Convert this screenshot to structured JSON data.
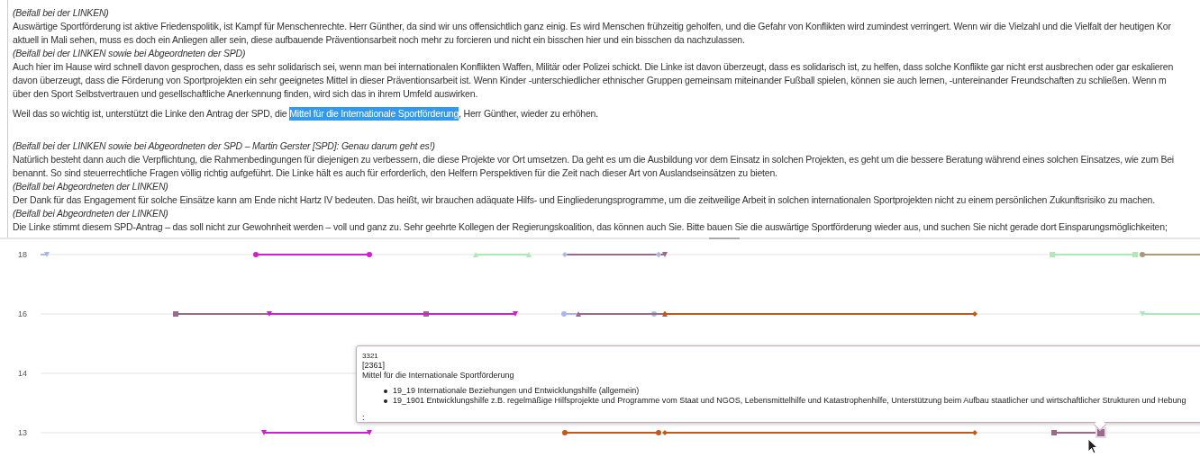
{
  "transcript": [
    {
      "kind": "applause",
      "lines": [
        [
          {
            "text": "(Beifall bei der LINKEN)",
            "selected": false
          }
        ]
      ]
    },
    {
      "kind": "speech",
      "lines": [
        [
          {
            "text": "Auswärtige Sportförderung ist aktive Friedenspolitik, ist Kampf für Menschenrechte. Herr Günther, da sind wir uns offensichtlich ganz einig. Es wird Menschen frühzeitig geholfen, und die Gefahr von Konflikten wird zumindest verringert. Wenn wir die Vielzahl und die Vielfalt der heutigen Kor",
            "selected": false
          }
        ],
        [
          {
            "text": "aktuell in Mali sehen, muss es doch ein Anliegen aller sein, diese aufbauende Präventionsarbeit noch mehr zu forcieren und nicht ein bisschen hier und ein bisschen da nachzulassen.",
            "selected": false
          }
        ]
      ]
    },
    {
      "kind": "applause",
      "lines": [
        [
          {
            "text": "(Beifall bei der LINKEN sowie bei Abgeordneten der SPD)",
            "selected": false
          }
        ]
      ]
    },
    {
      "kind": "speech",
      "lines": [
        [
          {
            "text": "Auch hier im Hause wird schnell davon gesprochen, dass es sehr solidarisch sei, wenn man bei internationalen Konflikten Waffen, Militär oder Polizei schickt. Die Linke ist davon überzeugt, dass es solidarisch ist, zu helfen, dass solche Konflikte gar nicht erst ausbrechen oder gar eskalieren",
            "selected": false
          }
        ],
        [
          {
            "text": "davon überzeugt, dass die Förderung von Sportprojekten ein sehr geeignetes Mittel in dieser Präventionsarbeit ist. Wenn Kinder -unterschiedlicher ethnischer Gruppen gemeinsam miteinander Fußball spielen, können sie auch lernen, -untereinander Freundschaften zu schließen. Wenn m",
            "selected": false
          }
        ],
        [
          {
            "text": "über den Sport Selbstvertrauen und gesellschaftliche Anerkennung finden, wird sich das in ihrem Umfeld auswirken.",
            "selected": false
          }
        ]
      ]
    },
    {
      "kind": "paragraph",
      "lines": [
        [
          {
            "text": "Weil das so wichtig ist, unterstützt die Linke den Antrag der SPD, die ",
            "selected": false
          },
          {
            "text": "Mittel für die Internationale Sportförderung",
            "selected": true
          },
          {
            "text": ", Herr Günther, wieder zu erhöhen.",
            "selected": false
          }
        ]
      ]
    },
    {
      "kind": "applause",
      "lines": [
        [
          {
            "text": "(Beifall bei der LINKEN sowie bei Abgeordneten der SPD – Martin Gerster [SPD]: Genau darum geht es!)",
            "selected": false
          }
        ]
      ]
    },
    {
      "kind": "speech",
      "lines": [
        [
          {
            "text": "Natürlich besteht dann auch die Verpflichtung, die Rahmenbedingungen für diejenigen zu verbessern, die diese Projekte vor Ort umsetzen. Da geht es um die Ausbildung vor dem Einsatz in solchen Projekten, es geht um die bessere Beratung während eines solchen Einsatzes, wie zum Bei",
            "selected": false
          }
        ],
        [
          {
            "text": "benannt. So sind steuerrechtliche Fragen völlig richtig aufgeführt. Die Linke hält es auch für erforderlich, den Helfern Perspektiven für die Zeit nach dieser Art von Auslandseinsätzen zu bieten.",
            "selected": false
          }
        ]
      ]
    },
    {
      "kind": "applause",
      "lines": [
        [
          {
            "text": "(Beifall bei Abgeordneten der LINKEN)",
            "selected": false
          }
        ]
      ]
    },
    {
      "kind": "speech",
      "lines": [
        [
          {
            "text": "Der Dank für das Engagement für solche Einsätze kann am Ende nicht Hartz IV bedeuten. Das heißt, wir brauchen adäquate Hilfs- und Eingliederungsprogramme, um die zeitweilige Arbeit in solchen internationalen Sportprojekten nicht zu einem persönlichen Zukunftsrisiko zu machen.",
            "selected": false
          }
        ]
      ]
    },
    {
      "kind": "applause",
      "lines": [
        [
          {
            "text": "(Beifall bei Abgeordneten der LINKEN)",
            "selected": false
          }
        ]
      ]
    },
    {
      "kind": "speech",
      "lines": [
        [
          {
            "text": "Die Linke stimmt diesem SPD-Antrag – das soll nicht zur Gewohnheit werden – voll und ganz zu. Sehr geehrte Kollegen der Regierungskoalition, das können auch Sie. Bitte bauen Sie die auswärtige Sportförderung wieder aus, und suchen Sie nicht gerade dort Einsparungsmöglichkeiten;",
            "selected": false
          }
        ]
      ]
    }
  ],
  "timeline": {
    "rows": [
      {
        "label": "18"
      },
      {
        "label": "16"
      },
      {
        "label": "14"
      },
      {
        "label": "13"
      }
    ]
  },
  "tooltip": {
    "id": "3321",
    "code": "[2361]",
    "title": "Mittel für die Internationale Sportförderung",
    "items": [
      "19_19 Internationale Beziehungen und Entwicklungshilfe (allgemein)",
      "19_1901 Entwicklungshilfe z.B. regelmäßige Hilfsprojekte und Programme vom Staat und NGOS, Lebensmittelhilfe und Katastrophenhilfe, Unterstützung beim Aufbau staatlicher und wirtschaftlicher Strukturen und Hebung"
    ],
    "footer": ":"
  }
}
